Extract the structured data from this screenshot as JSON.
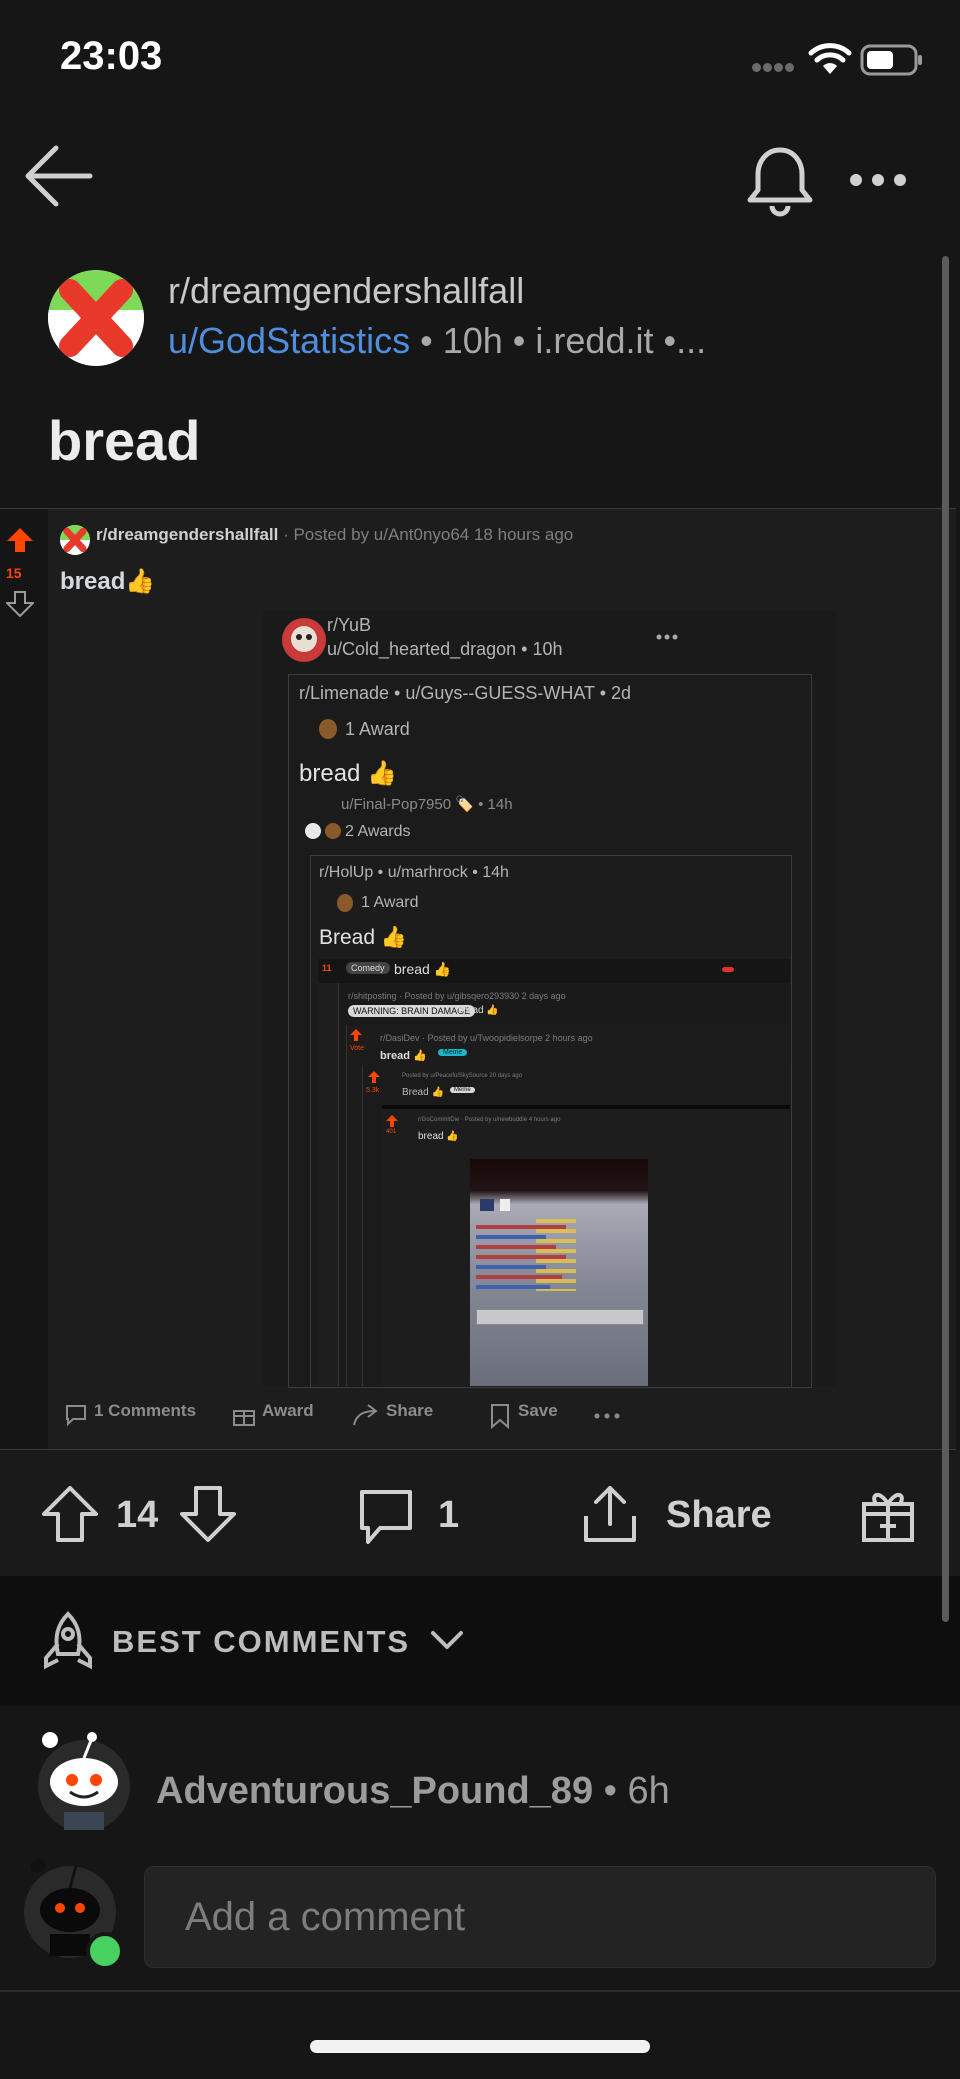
{
  "status_bar": {
    "time": "23:03"
  },
  "post": {
    "subreddit": "r/dreamgendershallfall",
    "author": "u/GodStatistics",
    "age": "10h",
    "domain": "i.redd.it",
    "meta_separator": " • ",
    "meta_ellipsis": "•...",
    "title": "bread"
  },
  "image": {
    "vote_count": "15",
    "header_sub": "r/dreamgendershallfall",
    "header_posted": "· Posted by u/Ant0nyo64 18 hours ago",
    "title": "bread👍",
    "card": {
      "sub": "r/YuB",
      "user_line": "u/Cold_hearted_dragon • 10h",
      "quote1_line": "r/Limenade • u/Guys--GUESS-WHAT • 2d",
      "quote1_award": "1 Award",
      "quote1_title": "bread 👍",
      "quote1_sub_line": "u/Final-Pop7950 🏷️ • 14h",
      "quote1_awards2": "2 Awards",
      "quote2_line": "r/HolUp • u/marhrock • 14h",
      "quote2_award": "1 Award",
      "quote2_title": "Bread 👍",
      "q3_flair": "Comedy",
      "q3_title": "bread 👍",
      "q3_count": "11",
      "q4_line": "r/shitposting · Posted by u/gibsqero293930 2 days ago",
      "q4_flair": "WARNING: BRAIN DAMAGE",
      "q4_title": "bread 👍",
      "q5_line": "r/DasiDev · Posted by u/Twoopidielsorpe 2 hours ago",
      "q5_title": "bread 👍",
      "q5_flair": "Meme",
      "q5_count": "Vote",
      "q6_line": "Posted by u/PeacefulSkySource 20 days ago",
      "q6_title": "Bread 👍",
      "q6_flair": "Meme",
      "q6_count": "5.3k",
      "q7_line": "r/GoCommitDie · Posted by u/newbuddie 4 hours ago",
      "q7_title": "bread 👍",
      "q7_count": "401"
    },
    "actions": {
      "comments": "1 Comments",
      "award": "Award",
      "share": "Share",
      "save": "Save"
    }
  },
  "action_bar": {
    "votes": "14",
    "comments": "1",
    "share": "Share"
  },
  "sort": {
    "label": "BEST COMMENTS"
  },
  "comment": {
    "author": "Adventurous_Pound_89",
    "age": " • 6h"
  },
  "composer": {
    "placeholder": "Add a comment"
  },
  "colors": {
    "background": "#161617",
    "upvote": "#ff4500",
    "link_blue": "#4f8ede",
    "online_green": "#46d160"
  }
}
